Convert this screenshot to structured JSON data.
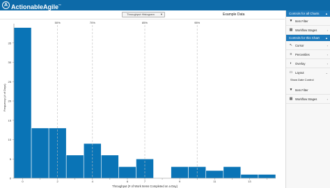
{
  "app": {
    "name": "ActionableAgile",
    "trademark": "™",
    "logo_glyph": "A"
  },
  "toolbar": {
    "chart_select": "Throughput Histogram",
    "dataset": "Example Data",
    "icons": [
      "folder-icon",
      "download-icon",
      "settings-icon",
      "help-icon"
    ]
  },
  "sidebar": {
    "all_charts_header": "Controls for all Charts",
    "all_items": [
      {
        "label": "Item Filter",
        "icon": "filter-icon"
      },
      {
        "label": "Workflow Stages",
        "icon": "stages-icon"
      }
    ],
    "this_chart_header": "Controls for this Chart",
    "chart_items": [
      {
        "label": "Cursor",
        "icon": "cursor-icon"
      },
      {
        "label": "Percentiles",
        "icon": "percentiles-icon"
      },
      {
        "label": "Overlay",
        "icon": "overlay-icon"
      },
      {
        "label": "Layout",
        "icon": "layout-icon"
      }
    ],
    "layout_option": "Show Date Control",
    "bottom_items": [
      {
        "label": "Item Filter",
        "icon": "filter-icon"
      },
      {
        "label": "Workflow Stages",
        "icon": "stages-icon"
      }
    ]
  },
  "chart_data": {
    "type": "bar",
    "xlabel": "Throughput (# of Work Items Completed on a Day)",
    "ylabel": "Frequency (# of Days)",
    "categories": [
      "0",
      "1",
      "2",
      "3",
      "4",
      "5",
      "6",
      "7",
      "8",
      "9",
      "10",
      "11",
      "12",
      "13",
      "14"
    ],
    "x_tick_labels": [
      "0",
      "",
      "2",
      "",
      "4",
      "",
      "6",
      "7",
      "",
      "9",
      "",
      "11",
      "",
      "13",
      ""
    ],
    "values": [
      39,
      13,
      13,
      6,
      9,
      6,
      3,
      5,
      0,
      3,
      3,
      2,
      3,
      1,
      1
    ],
    "ylim": [
      0,
      40
    ],
    "y_ticks": [
      0,
      5,
      10,
      15,
      20,
      25,
      30,
      35
    ],
    "percentiles": [
      {
        "label": "50%",
        "x": 2
      },
      {
        "label": "70%",
        "x": 4
      },
      {
        "label": "85%",
        "x": 7
      },
      {
        "label": "95%",
        "x": 10
      }
    ],
    "bar_color": "#0a74b6"
  }
}
